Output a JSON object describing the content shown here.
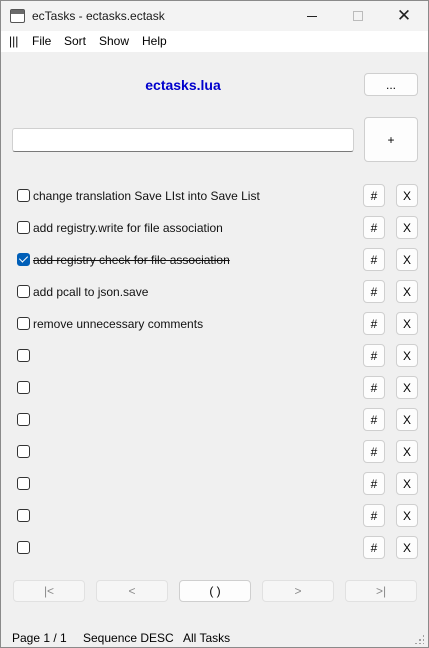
{
  "window": {
    "title": "ecTasks - ectasks.ectask"
  },
  "menu": {
    "items": [
      "|||",
      "File",
      "Sort",
      "Show",
      "Help"
    ]
  },
  "header": {
    "title": "ectasks.lua",
    "title_color": "#0000cc",
    "more_label": "...",
    "add_label": "+"
  },
  "new_task": {
    "value": "",
    "placeholder": ""
  },
  "tasks": [
    {
      "label": "change translation Save LIst into Save List",
      "checked": false
    },
    {
      "label": "add registry.write for file association",
      "checked": false
    },
    {
      "label": "add registry check for file association",
      "checked": true
    },
    {
      "label": "add pcall to json.save",
      "checked": false
    },
    {
      "label": "remove unnecessary comments",
      "checked": false
    },
    {
      "label": "",
      "checked": false
    },
    {
      "label": "",
      "checked": false
    },
    {
      "label": "",
      "checked": false
    },
    {
      "label": "",
      "checked": false
    },
    {
      "label": "",
      "checked": false
    },
    {
      "label": "",
      "checked": false
    },
    {
      "label": "",
      "checked": false
    }
  ],
  "row_buttons": {
    "edit_label": "#",
    "delete_label": "X"
  },
  "pager": {
    "first": "|<",
    "prev": "<",
    "current": "( )",
    "next": ">",
    "last": ">|"
  },
  "status": {
    "page": "Page 1 / 1",
    "sequence": "Sequence DESC",
    "filter": "All Tasks"
  },
  "colors": {
    "checkbox_checked": "#005fb8"
  }
}
